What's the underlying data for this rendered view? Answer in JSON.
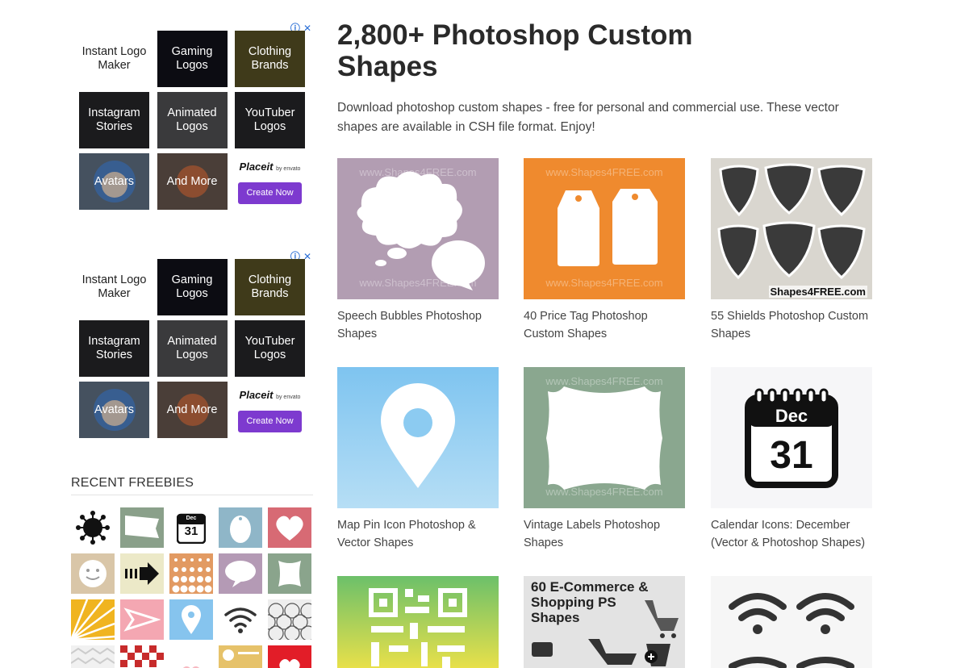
{
  "ads": [
    {
      "tiles": [
        "Instant Logo Maker",
        "Gaming Logos",
        "Clothing Brands",
        "Instagram Stories",
        "Animated Logos",
        "YouTuber Logos",
        "Avatars",
        "And More"
      ],
      "placeit": {
        "logo": "Placeit",
        "by": "by envato",
        "button": "Create Now"
      }
    },
    {
      "tiles": [
        "Instant Logo Maker",
        "Gaming Logos",
        "Clothing Brands",
        "Instagram Stories",
        "Animated Logos",
        "YouTuber Logos",
        "Avatars",
        "And More"
      ],
      "placeit": {
        "logo": "Placeit",
        "by": "by envato",
        "button": "Create Now"
      }
    }
  ],
  "ad_icons": {
    "info": "ⓘ",
    "close": "✕"
  },
  "sidebar": {
    "recent_title": "RECENT FREEBIES",
    "calendar_thumb": {
      "month": "Dec",
      "day": "31"
    }
  },
  "main": {
    "title": "2,800+ Photoshop Custom Shapes",
    "intro": "Download photoshop custom shapes - free for personal and commercial use. These vector shapes are available in CSH file format. Enjoy!",
    "watermark": "www.Shapes4FREE.com",
    "cards": [
      {
        "caption": "Speech Bubbles Photoshop Shapes"
      },
      {
        "caption": "40 Price Tag Photoshop Custom Shapes"
      },
      {
        "caption": "55 Shields Photoshop Custom Shapes",
        "brand": "Shapes4FREE.com"
      },
      {
        "caption": "Map Pin Icon Photoshop & Vector Shapes"
      },
      {
        "caption": "Vintage Labels Photoshop Shapes"
      },
      {
        "caption": "Calendar Icons: December (Vector & Photoshop Shapes)",
        "month": "Dec",
        "day": "31"
      },
      {
        "caption": ""
      },
      {
        "caption": "",
        "overlay": "60 E-Commerce & Shopping PS Shapes"
      },
      {
        "caption": ""
      }
    ]
  },
  "colors": {
    "accent_purple": "#7d3acf",
    "ad_icon_blue": "#2b6fd6"
  }
}
